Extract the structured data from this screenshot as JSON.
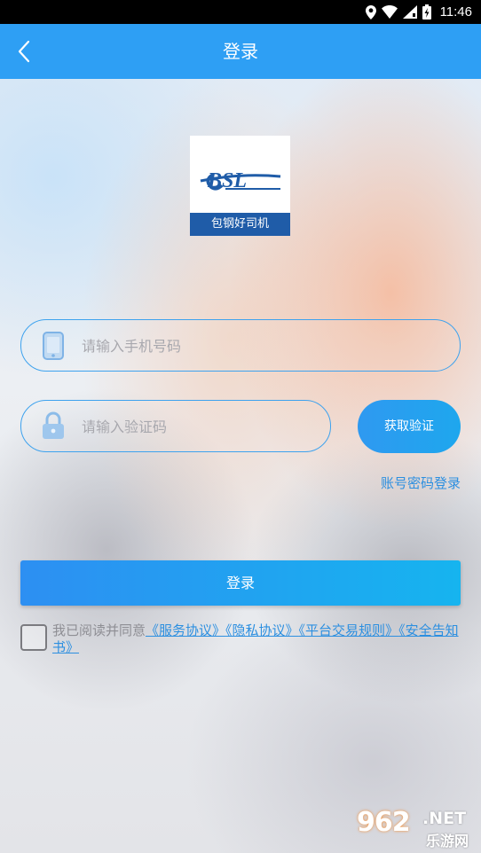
{
  "status_bar": {
    "time": "11:46"
  },
  "nav": {
    "title": "登录"
  },
  "logo": {
    "text": "包钢好司机",
    "mark": "BSL"
  },
  "form": {
    "phone_placeholder": "请输入手机号码",
    "code_placeholder": "请输入验证码",
    "get_code_label": "获取验证",
    "password_login_label": "账号密码登录",
    "login_label": "登录"
  },
  "agreement": {
    "checked": false,
    "prefix": "我已阅读并同意",
    "links": [
      "《服务协议》",
      "《隐私协议》",
      "《平台交易规则》",
      "《安全告知书》"
    ]
  },
  "watermark": {
    "number": "962",
    "suffix": ".NET",
    "subtitle": "乐游网"
  },
  "colors": {
    "accent": "#2e9ff4",
    "link": "#2c8fe0",
    "logo_band": "#1f5ca8"
  }
}
